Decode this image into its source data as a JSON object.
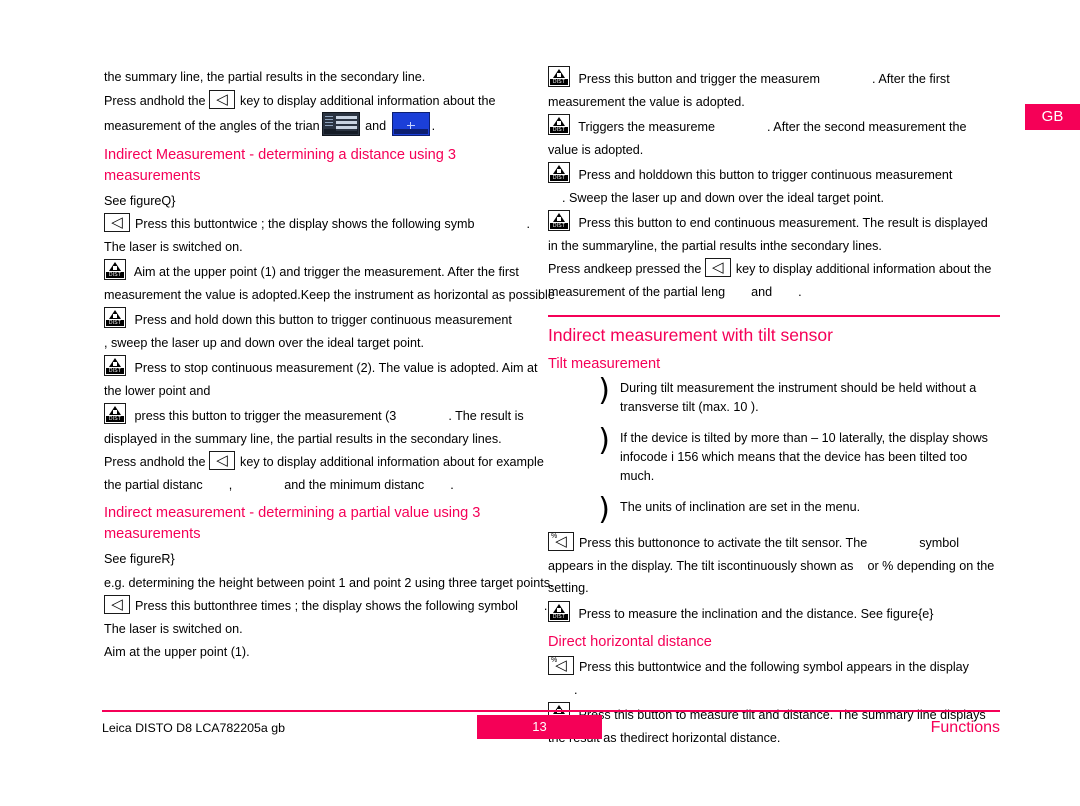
{
  "language_tab": "GB",
  "left_column": {
    "para_intro": "the summary line, the partial results in the secondary line.",
    "para_press_hold_pre": "Press and",
    "para_press_hold_hold": "hold",
    "para_press_hold_the": " the ",
    "para_press_hold_post": "key to display additional information about the measurement of the angles of the trian",
    "para_press_hold_and": " and ",
    "para_press_hold_end": ".",
    "heading_indirect_3_meas": "Indirect Measurement - determining a distance using 3 measurements",
    "see_figure_1": "See figure",
    "see_figure_1_ref": "Q}",
    "step_press_twice_a": "Press this button",
    "step_press_twice_b": "twice",
    "step_press_twice_c": "; the display shows the following symb",
    "step_press_twice_d": ".",
    "step_laser_on": "The laser is switched on.",
    "step_aim_upper_a": "Aim at the upper point (1) and trigger the measurement. After the first measurement the value is adopted.",
    "step_aim_upper_b": "Keep the instrument as horizontal as possible",
    "step_hold_continuous_a": "Press and hold down this button to trigger continuous measurement",
    "step_hold_continuous_b": ", sweep the laser up and down over the ideal target point.",
    "step_stop_continuous_a": "Press to stop continuous measurement (2). The value is adopted. Aim at the lower point and",
    "step_trigger_third_a": "press this button to trigger t",
    "step_trigger_third_b": "he measurement (3",
    "step_trigger_third_c": ". The result is displayed in the summa",
    "step_trigger_third_d": "ry line, the partial results in the secondary lines.",
    "step_press_hold2_a": "Press and",
    "step_press_hold2_b": "hold",
    "step_press_hold2_c": " the ",
    "step_press_hold2_d": "key to display additional information about for example the partial distanc",
    "step_press_hold2_e": ",",
    "step_press_hold2_f": "and the minimum distanc",
    "step_press_hold2_g": ".",
    "heading_indirect_partial": "Indirect measurement - determining a partial value using 3 measurements",
    "see_figure_2": "See figure",
    "see_figure_2_ref": "R}",
    "para_eg_height": "e.g. determining the height between point 1 and point 2 using three target points.",
    "step_press_three_a": "Press this button",
    "step_press_three_b": "three times",
    "step_press_three_c": "; the display shows the following symbol",
    "step_press_three_d": ". The laser is switched on.",
    "step_aim_upper_point": "Aim at the upper point (1)."
  },
  "right_column": {
    "step_press_trigger_a": "Press this button and trigger the measurem",
    "step_press_trigger_b": ". After the first measurement the value is adopted.",
    "step_triggers_a": "Triggers the measureme",
    "step_triggers_b": ". After the second measurement the value is adopted.",
    "step_hold_cont_a": "Press and hold",
    "step_hold_cont_b": "down this button to trigger continuous measurement",
    "step_hold_cont_c": ". Sweep the laser up and down over the ideal target point.",
    "step_end_cont_a": "Press this button to end continuous measurement. The result is displayed in the summary",
    "step_end_cont_b": "line, the partial results in",
    "step_end_cont_c": "the secondary lines.",
    "step_keep_pressed_a": "Press and",
    "step_keep_pressed_b": "keep pressed the ",
    "step_keep_pressed_c": "key to display additional information about the measurement of the partial leng",
    "step_keep_pressed_d": "and",
    "step_keep_pressed_e": ".",
    "heading_tilt_sensor": "Indirect measurement with tilt sensor",
    "heading_tilt_measurement": "Tilt measurement",
    "note_1": "During tilt measurement the instrument should be held without a transverse tilt (max. 10 ).",
    "note_2": "If the device is tilted by more than – 10  laterally, the display shows infocode i 156 which means that the device has been tilted too much.",
    "note_3": "The units of inclination are set in the menu.",
    "bullet_glyph": ")",
    "step_tilt_once_a": "Press this button",
    "step_tilt_once_b": "once to activate the tilt sensor. The",
    "step_tilt_once_c": "symbol appears in the display. The tilt is",
    "step_tilt_once_d": "continuously shown as",
    "step_tilt_once_e": "or % depending on the setting.",
    "step_measure_incl_a": "Press to measure the inclinati",
    "step_measure_incl_b": "on and the distance. See figu",
    "step_measure_incl_c": "re",
    "step_measure_incl_d": "{e}",
    "heading_direct_horizontal": "Direct horizontal distance",
    "step_twice_a": "Press this button",
    "step_twice_b": "twice",
    "step_twice_c": "and the following symbol appears in the display",
    "step_twice_d": ".",
    "step_measure_tilt_a": "Press this button to measure tilt and distance. The summary line displays the result as the",
    "step_measure_tilt_b": "direct horizontal distance."
  },
  "footer": {
    "left": "Leica DISTO  D8 LCA782205a gb",
    "page_number": "13",
    "right": "Functions"
  },
  "icons": {
    "angle_key": "◁",
    "tilt_key": "◁",
    "tilt_percent": "%",
    "dist_label": "DIST",
    "dist_on": "ON"
  },
  "colors": {
    "accent": "#f50057",
    "text": "#000000",
    "background": "#ffffff"
  }
}
